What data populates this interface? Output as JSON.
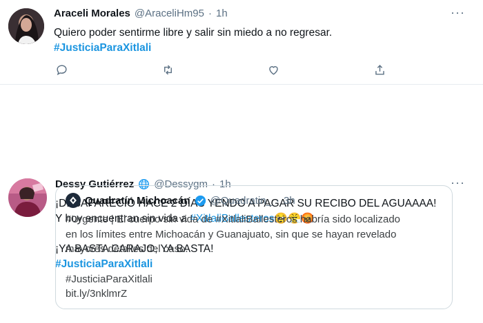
{
  "tweets": [
    {
      "author_name": "Araceli Morales",
      "handle": "@AraceliHm95",
      "separator": "·",
      "time": "1h",
      "text_line1": "Quiero poder sentirme libre y salir sin miedo a no regresar.",
      "hashtag": "#JusticiaParaXitlali",
      "more_icon": "more-horizontal-icon",
      "actions": [
        "reply-icon",
        "retweet-icon",
        "like-icon",
        "share-icon"
      ]
    },
    {
      "author_name": "Dessy Gutiérrez",
      "verified_icon": "globe-icon",
      "handle": "@Dessygm",
      "separator": "·",
      "time": "1h",
      "line1": "¡DESAPARECIÓ HACE 2 DÍAS YENDO A PAGAR SU RECIBO DEL AGUAAAA!",
      "line2_prefix": "Y hoy encuentran sin vida a ",
      "line2_hashtag": "#XitlaliBallesteros",
      "emojis": [
        "🥺",
        "😤",
        "😡"
      ],
      "line3": "¡YA BASTA CARAJO, YA BASTA!",
      "hashtag": "#JusticiaParaXitlali",
      "more_icon": "more-horizontal-icon",
      "quoted": {
        "author_name": "Quadratín Michoacán",
        "verified_icon": "verified-badge-icon",
        "handle": "@Quadratin_",
        "separator": "·",
        "time": "3h",
        "line1": "#Urgente | El cuerpo sin vida de #XitlaliBallesteros habría sido localizado",
        "line2": "en los límites entre Michoacán y Guanajuato, sin que se hayan revelado",
        "line3": "mayores detalles del caso.",
        "hashtag": "#JusticiaParaXitlali",
        "link": "bit.ly/3nklmrZ"
      }
    }
  ],
  "colors": {
    "link": "#1b95e0",
    "muted": "#5b7083",
    "verified": "#1d9bf0"
  }
}
